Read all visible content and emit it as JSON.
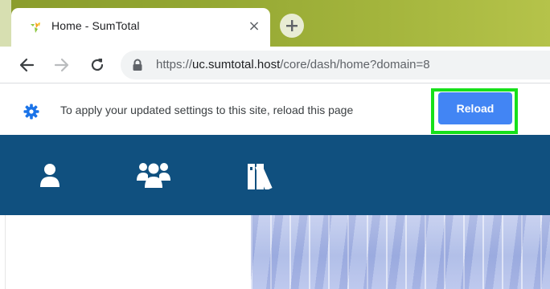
{
  "browser": {
    "tab": {
      "title": "Home - SumTotal",
      "close_glyph": "×",
      "favicon": "sumtotal-logo-icon"
    },
    "new_tab_icon": "plus-icon",
    "nav": {
      "back_icon": "arrow-left-icon",
      "forward_icon": "arrow-right-icon",
      "reload_icon": "refresh-icon"
    },
    "address": {
      "scheme": "https://",
      "host": "uc.sumtotal.host",
      "path": "/core/dash/home?domain=8",
      "lock_icon": "lock-icon"
    }
  },
  "infobar": {
    "icon": "gear-icon",
    "message": "To apply your updated settings to this site, reload this page",
    "reload_label": "Reload",
    "highlight_color": "#16e01a",
    "button_color": "#4285f4"
  },
  "site_header": {
    "background": "#10507f",
    "icons": [
      "person-icon",
      "group-icon",
      "library-icon"
    ]
  },
  "colors": {
    "tabstrip": "#93a632",
    "text_primary": "#202124",
    "text_secondary": "#5f6368"
  }
}
